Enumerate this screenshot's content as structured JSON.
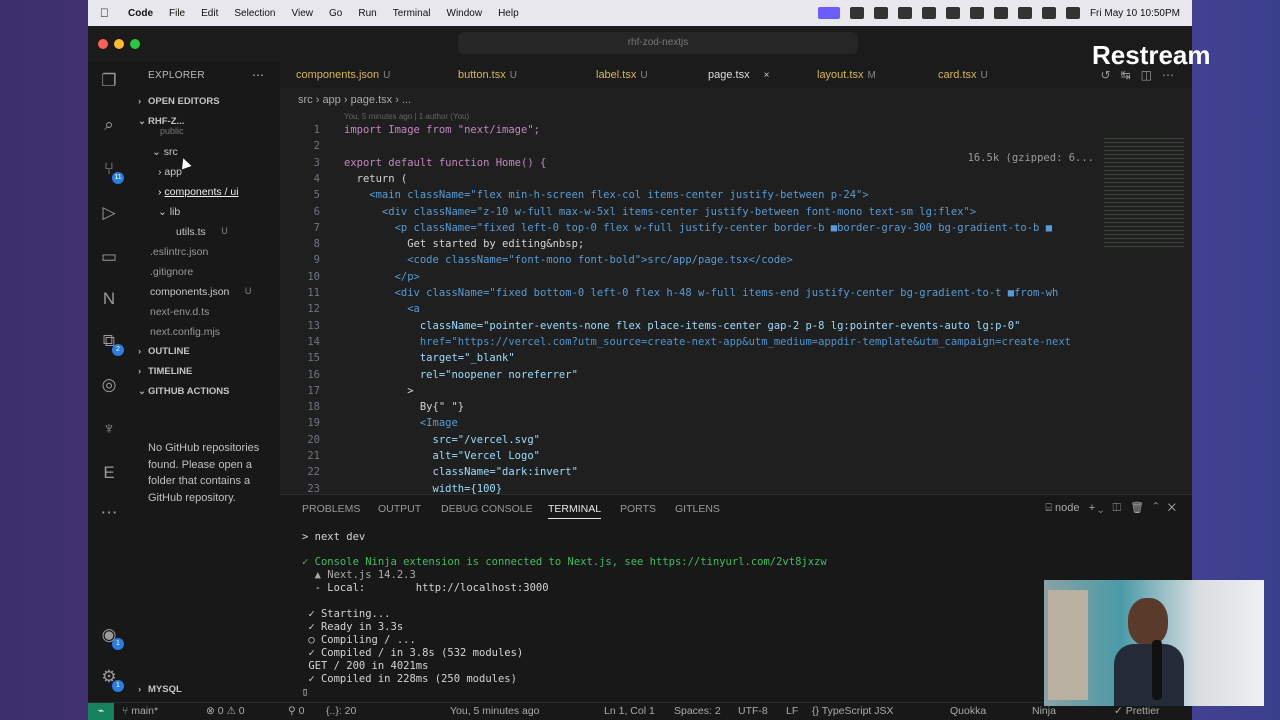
{
  "menubar": {
    "items": [
      "Code",
      "File",
      "Edit",
      "Selection",
      "View",
      "Go",
      "Run",
      "Terminal",
      "Window",
      "Help"
    ],
    "clock": "Fri May 10  10:50PM"
  },
  "window": {
    "command_center": "rhf-zod-nextjs"
  },
  "activity_bar": {
    "source_control_badge": "11",
    "extensions_badge": "2",
    "accounts_badge": "1",
    "settings_badge": "1"
  },
  "sidebar": {
    "title": "EXPLORER",
    "sections": {
      "open_editors": "OPEN EDITORS",
      "project": "RHF-Z...",
      "outline": "OUTLINE",
      "timeline": "TIMELINE",
      "github_actions": "GITHUB ACTIONS",
      "mysql": "MYSQL"
    },
    "tree": [
      {
        "label": "public",
        "mark": ""
      },
      {
        "label": "src",
        "mark": ""
      },
      {
        "label": "app",
        "mark": ""
      },
      {
        "label": "components / ui",
        "mark": ""
      },
      {
        "label": "lib",
        "mark": ""
      },
      {
        "label": "utils.ts",
        "mark": "U"
      },
      {
        "label": ".eslintrc.json",
        "mark": ""
      },
      {
        "label": ".gitignore",
        "mark": ""
      },
      {
        "label": "components.json",
        "mark": "U"
      },
      {
        "label": "next-env.d.ts",
        "mark": ""
      },
      {
        "label": "next.config.mjs",
        "mark": ""
      }
    ],
    "github_message": "No GitHub repositories found. Please open a folder that contains a GitHub repository."
  },
  "tabs": [
    {
      "label": "components.json",
      "mark": "U"
    },
    {
      "label": "button.tsx",
      "mark": "U"
    },
    {
      "label": "label.tsx",
      "mark": "U"
    },
    {
      "label": "page.tsx",
      "mark": "×"
    },
    {
      "label": "layout.tsx",
      "mark": "M"
    },
    {
      "label": "card.tsx",
      "mark": "U"
    }
  ],
  "breadcrumb": "src  ›  app  ›  page.tsx  ›  ...",
  "editor": {
    "blame": "You, 5 minutes ago | 1 author (You)",
    "size_hint": "16.5k (gzipped: 6...",
    "lines": [
      {
        "n": "1",
        "text": "import Image from \"next/image\";"
      },
      {
        "n": "2",
        "text": ""
      },
      {
        "n": "3",
        "text": "export default function Home() {"
      },
      {
        "n": "4",
        "text": "  return ("
      },
      {
        "n": "5",
        "text": "    <main className=\"flex min-h-screen flex-col items-center justify-between p-24\">"
      },
      {
        "n": "6",
        "text": "      <div className=\"z-10 w-full max-w-5xl items-center justify-between font-mono text-sm lg:flex\">"
      },
      {
        "n": "7",
        "text": "        <p className=\"fixed left-0 top-0 flex w-full justify-center border-b ■border-gray-300 bg-gradient-to-b ■"
      },
      {
        "n": "8",
        "text": "          Get started by editing&nbsp;"
      },
      {
        "n": "9",
        "text": "          <code className=\"font-mono font-bold\">src/app/page.tsx</code>"
      },
      {
        "n": "10",
        "text": "        </p>"
      },
      {
        "n": "11",
        "text": "        <div className=\"fixed bottom-0 left-0 flex h-48 w-full items-end justify-center bg-gradient-to-t ■from-wh"
      },
      {
        "n": "12",
        "text": "          <a"
      },
      {
        "n": "13",
        "text": "            className=\"pointer-events-none flex place-items-center gap-2 p-8 lg:pointer-events-auto lg:p-0\""
      },
      {
        "n": "14",
        "text": "            href=\"https://vercel.com?utm_source=create-next-app&utm_medium=appdir-template&utm_campaign=create-next"
      },
      {
        "n": "15",
        "text": "            target=\"_blank\""
      },
      {
        "n": "16",
        "text": "            rel=\"noopener noreferrer\""
      },
      {
        "n": "17",
        "text": "          >"
      },
      {
        "n": "18",
        "text": "            By{\" \"}"
      },
      {
        "n": "19",
        "text": "            <Image"
      },
      {
        "n": "20",
        "text": "              src=\"/vercel.svg\""
      },
      {
        "n": "21",
        "text": "              alt=\"Vercel Logo\""
      },
      {
        "n": "22",
        "text": "              className=\"dark:invert\""
      },
      {
        "n": "23",
        "text": "              width={100}"
      }
    ]
  },
  "panel": {
    "tabs": [
      "PROBLEMS",
      "OUTPUT",
      "DEBUG CONSOLE",
      "TERMINAL",
      "PORTS",
      "GITLENS"
    ],
    "active_tab": "TERMINAL",
    "shell": "node",
    "terminal_lines": [
      "> next dev",
      "",
      "✓ Console Ninja extension is connected to Next.js, see https://tinyurl.com/2vt8jxzw",
      "  ▲ Next.js 14.2.3",
      "  - Local:        http://localhost:3000",
      "",
      " ✓ Starting...",
      " ✓ Ready in 3.3s",
      " ○ Compiling / ...",
      " ✓ Compiled / in 3.8s (532 modules)",
      " GET / 200 in 4021ms",
      " ✓ Compiled in 228ms (250 modules)",
      "▯"
    ]
  },
  "status": {
    "branch": "main*",
    "errors": "⊗ 0 ⚠ 0",
    "ports": "⚲ 0",
    "selection": "{..}: 20",
    "blame": "You, 5 minutes ago",
    "position": "Ln 1, Col 1",
    "spaces": "Spaces: 2",
    "encoding": "UTF-8",
    "eol": "LF",
    "language": "{} TypeScript JSX",
    "quokka": "Quokka",
    "ninja": "Ninja",
    "prettier": "✓ Prettier"
  },
  "overlay": {
    "brand": "Restream"
  }
}
